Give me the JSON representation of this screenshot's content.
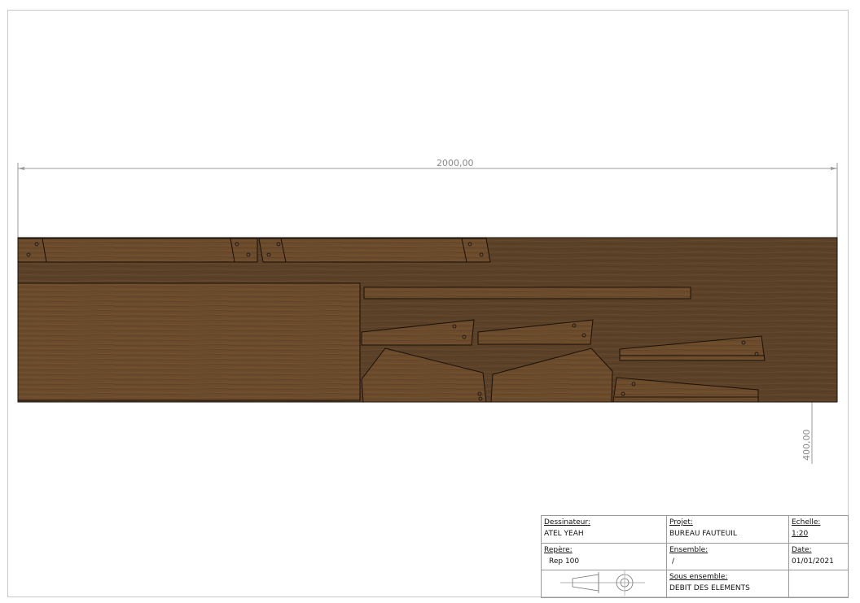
{
  "dimensions": {
    "width_label": "2000,00",
    "height_label": "400,00"
  },
  "title_block": {
    "dessinateur_label": "Dessinateur:",
    "dessinateur_value": "ATEL YEAH",
    "projet_label": "Projet:",
    "projet_value": "BUREAU FAUTEUIL",
    "echelle_label": "Echelle:",
    "echelle_value": "1:20",
    "repere_label": "Repère:",
    "repere_value": "Rep 100",
    "ensemble_label": "Ensemble:",
    "ensemble_value": "/",
    "date_label": "Date:",
    "date_value": "01/01/2021",
    "sous_ensemble_label": "Sous ensemble:",
    "sous_ensemble_value": "DEBIT DES ELEMENTS"
  },
  "colors": {
    "board": "#5a4026",
    "piece": "#6a4a2b",
    "outline": "#1a1108",
    "dimension_line": "#9a9a9a"
  }
}
